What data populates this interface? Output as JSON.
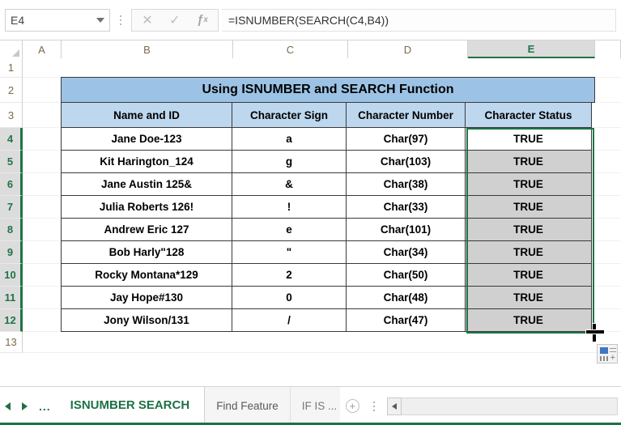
{
  "formula_bar": {
    "name_box_value": "E4",
    "cancel_icon": "close-icon",
    "enter_icon": "check-icon",
    "function_icon": "fx-icon",
    "formula": "=ISNUMBER(SEARCH(C4,B4))"
  },
  "grid": {
    "columns": [
      "A",
      "B",
      "C",
      "D",
      "E"
    ],
    "selected_column": "E",
    "rows": [
      "1",
      "2",
      "3",
      "4",
      "5",
      "6",
      "7",
      "8",
      "9",
      "10",
      "11",
      "12",
      "13"
    ],
    "selected_rows": [
      "4",
      "5",
      "6",
      "7",
      "8",
      "9",
      "10",
      "11",
      "12"
    ]
  },
  "table": {
    "title": "Using ISNUMBER and SEARCH Function",
    "headers": [
      "Name and ID",
      "Character Sign",
      "Character Number",
      "Character Status"
    ],
    "rows": [
      {
        "name": "Jane Doe-123",
        "sign": "a",
        "number": "Char(97)",
        "status": "TRUE"
      },
      {
        "name": "Kit Harington_124",
        "sign": "g",
        "number": "Char(103)",
        "status": "TRUE"
      },
      {
        "name": "Jane Austin 125&",
        "sign": "&",
        "number": "Char(38)",
        "status": "TRUE"
      },
      {
        "name": "Julia Roberts 126!",
        "sign": "!",
        "number": "Char(33)",
        "status": "TRUE"
      },
      {
        "name": "Andrew Eric 127",
        "sign": "e",
        "number": "Char(101)",
        "status": "TRUE"
      },
      {
        "name": "Bob Harly\"128",
        "sign": "\"",
        "number": "Char(34)",
        "status": "TRUE"
      },
      {
        "name": "Rocky Montana*129",
        "sign": "2",
        "number": "Char(50)",
        "status": "TRUE"
      },
      {
        "name": "Jay Hope#130",
        "sign": "0",
        "number": "Char(48)",
        "status": "TRUE"
      },
      {
        "name": "Jony Wilson/131",
        "sign": "/",
        "number": "Char(47)",
        "status": "TRUE"
      }
    ]
  },
  "sheet_tabs": {
    "first_label": "◄",
    "prev_icon": "nav-left-icon",
    "next_icon": "nav-right-icon",
    "overflow_label": "...",
    "tabs": [
      {
        "label": "ISNUMBER SEARCH",
        "active": true
      },
      {
        "label": "Find Feature",
        "active": false
      },
      {
        "label": "IF IS ...",
        "active": false
      }
    ],
    "add_sheet_label": "+",
    "scroll_left_icon": "scroll-left-icon"
  },
  "colors": {
    "accent_green": "#217346",
    "title_fill": "#9cc3e5",
    "header_fill": "#bdd7ee",
    "selection_fill": "#d0d0d0"
  }
}
